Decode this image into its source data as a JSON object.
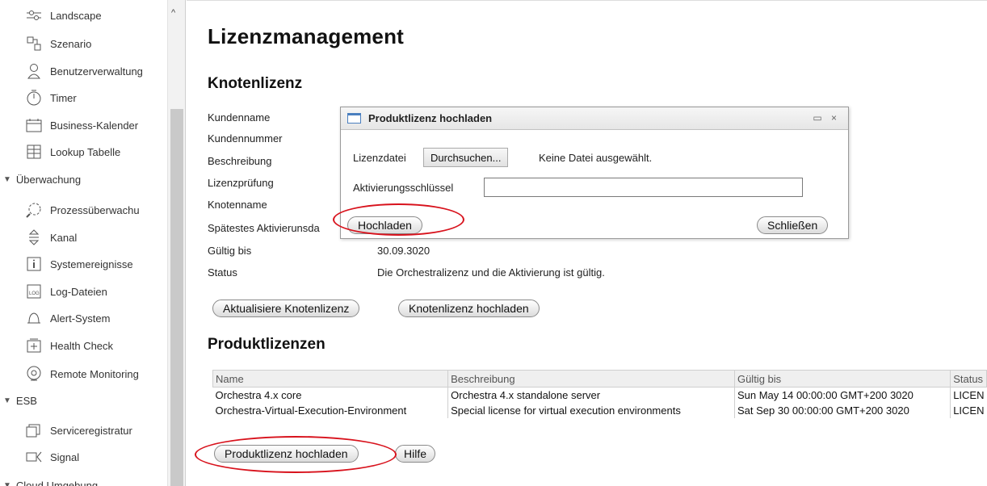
{
  "sidebar": {
    "items": [
      {
        "label": "Landscape",
        "icon": "landscape-icon",
        "glyph": "⚲"
      },
      {
        "label": "Szenario",
        "icon": "scenario-icon",
        "glyph": "⊞"
      },
      {
        "label": "Benutzerverwaltung",
        "icon": "user-icon",
        "glyph": "♙"
      },
      {
        "label": "Timer",
        "icon": "timer-icon",
        "glyph": "◷"
      },
      {
        "label": "Business-Kalender",
        "icon": "calendar-icon",
        "glyph": "▭"
      },
      {
        "label": "Lookup Tabelle",
        "icon": "table-icon",
        "glyph": "☷"
      }
    ],
    "group_monitoring": "Überwachung",
    "monitoring_items": [
      {
        "label": "Prozessüberwachu",
        "icon": "process-monitor-icon",
        "glyph": "⌕"
      },
      {
        "label": "Kanal",
        "icon": "channel-icon",
        "glyph": "⇕"
      },
      {
        "label": "Systemereignisse",
        "icon": "info-icon",
        "glyph": "ⅰ"
      },
      {
        "label": "Log-Dateien",
        "icon": "log-icon",
        "glyph": "▤"
      },
      {
        "label": "Alert-System",
        "icon": "bell-icon",
        "glyph": "⌂"
      },
      {
        "label": "Health Check",
        "icon": "health-check-icon",
        "glyph": "⊞"
      },
      {
        "label": "Remote Monitoring",
        "icon": "remote-monitoring-icon",
        "glyph": "⚙"
      }
    ],
    "group_esb": "ESB",
    "esb_items": [
      {
        "label": "Serviceregistratur",
        "icon": "registry-icon",
        "glyph": "❐"
      },
      {
        "label": "Signal",
        "icon": "signal-icon",
        "glyph": "⊲"
      }
    ],
    "group_cloud": "Cloud Umgebung"
  },
  "main": {
    "title": "Lizenzmanagement",
    "node_section_title": "Knotenlizenz",
    "fields": [
      {
        "label": "Kundenname",
        "value": ""
      },
      {
        "label": "Kundennummer",
        "value": ""
      },
      {
        "label": "Beschreibung",
        "value": ""
      },
      {
        "label": "Lizenzprüfung",
        "value": ""
      },
      {
        "label": "Knotenname",
        "value": ""
      },
      {
        "label": "Spätestes Aktivierunsda",
        "value": ""
      },
      {
        "label": "Gültig bis",
        "value": "30.09.3020"
      },
      {
        "label": "Status",
        "value": "Die Orchestralizenz und die Aktivierung ist gültig."
      }
    ],
    "update_node_button": "Aktualisiere Knotenlizenz",
    "upload_node_button": "Knotenlizenz hochladen",
    "product_section_title": "Produktlizenzen",
    "table": {
      "headers": [
        "Name",
        "Beschreibung",
        "Gültig bis",
        "Status"
      ],
      "rows": [
        [
          "Orchestra 4.x core",
          "Orchestra 4.x standalone server",
          "Sun May 14 00:00:00 GMT+200 3020",
          "LICEN"
        ],
        [
          "Orchestra-Virtual-Execution-Environment",
          "Special license for virtual execution environments",
          "Sat Sep 30 00:00:00 GMT+200 3020",
          "LICEN"
        ]
      ]
    },
    "upload_product_button": "Produktlizenz hochladen",
    "help_button": "Hilfe"
  },
  "dialog": {
    "title": "Produktlizenz hochladen",
    "controls": "▭ ×",
    "file_label": "Lizenzdatei",
    "browse_button": "Durchsuchen...",
    "no_file_text": "Keine Datei ausgewählt.",
    "activation_label": "Aktivierungsschlüssel",
    "activation_value": "",
    "upload_button": "Hochladen",
    "close_button": "Schließen"
  },
  "colors": {
    "highlight": "#d8121c",
    "header_bg": "#efefef"
  }
}
